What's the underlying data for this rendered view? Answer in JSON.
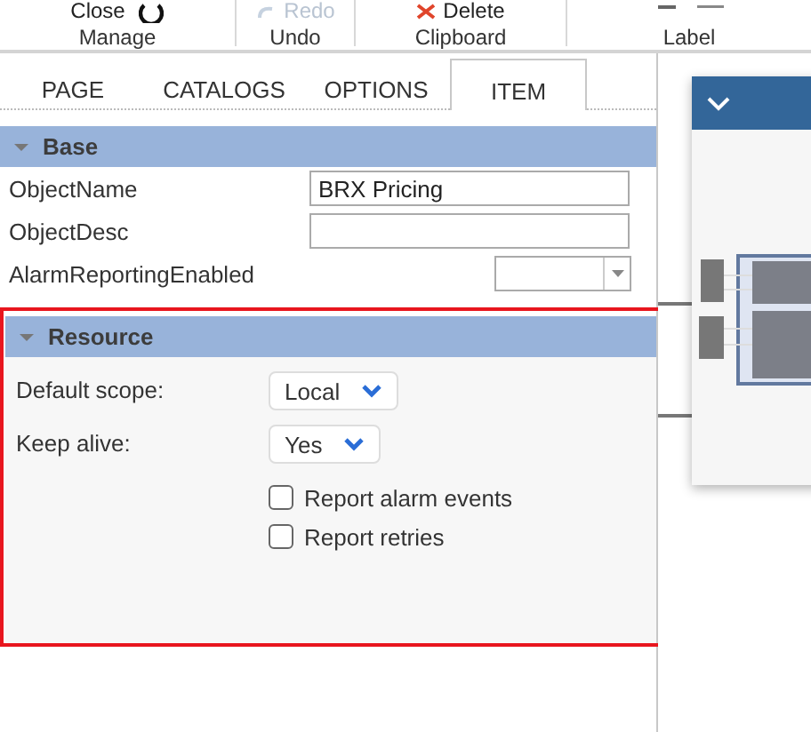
{
  "ribbon": {
    "groups": [
      {
        "label": "Manage",
        "buttons": [
          {
            "label": "Close",
            "disabled": false
          }
        ]
      },
      {
        "label": "Undo",
        "buttons": [
          {
            "label": "Redo",
            "disabled": true
          }
        ]
      },
      {
        "label": "Clipboard",
        "buttons": [
          {
            "label": "Delete",
            "disabled": false
          }
        ]
      },
      {
        "label": "Label"
      }
    ]
  },
  "tabs": [
    {
      "label": "PAGE",
      "selected": false
    },
    {
      "label": "CATALOGS",
      "selected": false
    },
    {
      "label": "OPTIONS",
      "selected": false
    },
    {
      "label": "ITEM",
      "selected": true
    }
  ],
  "base": {
    "title": "Base",
    "expanded": true,
    "properties": [
      {
        "name": "ObjectName",
        "kind": "text",
        "value": "BRX Pricing"
      },
      {
        "name": "ObjectDesc",
        "kind": "text"
      },
      {
        "name": "AlarmReportingEnabled",
        "kind": "dropdown"
      }
    ]
  },
  "resource": {
    "title": "Resource",
    "expanded": true,
    "highlighted": true,
    "fields": [
      {
        "label": "Default scope:",
        "value": "Local"
      },
      {
        "label": "Keep alive:",
        "value": "Yes"
      }
    ],
    "options": [
      {
        "label": "Report alarm events",
        "checked": false
      },
      {
        "label": "Report retries",
        "checked": false
      }
    ]
  }
}
